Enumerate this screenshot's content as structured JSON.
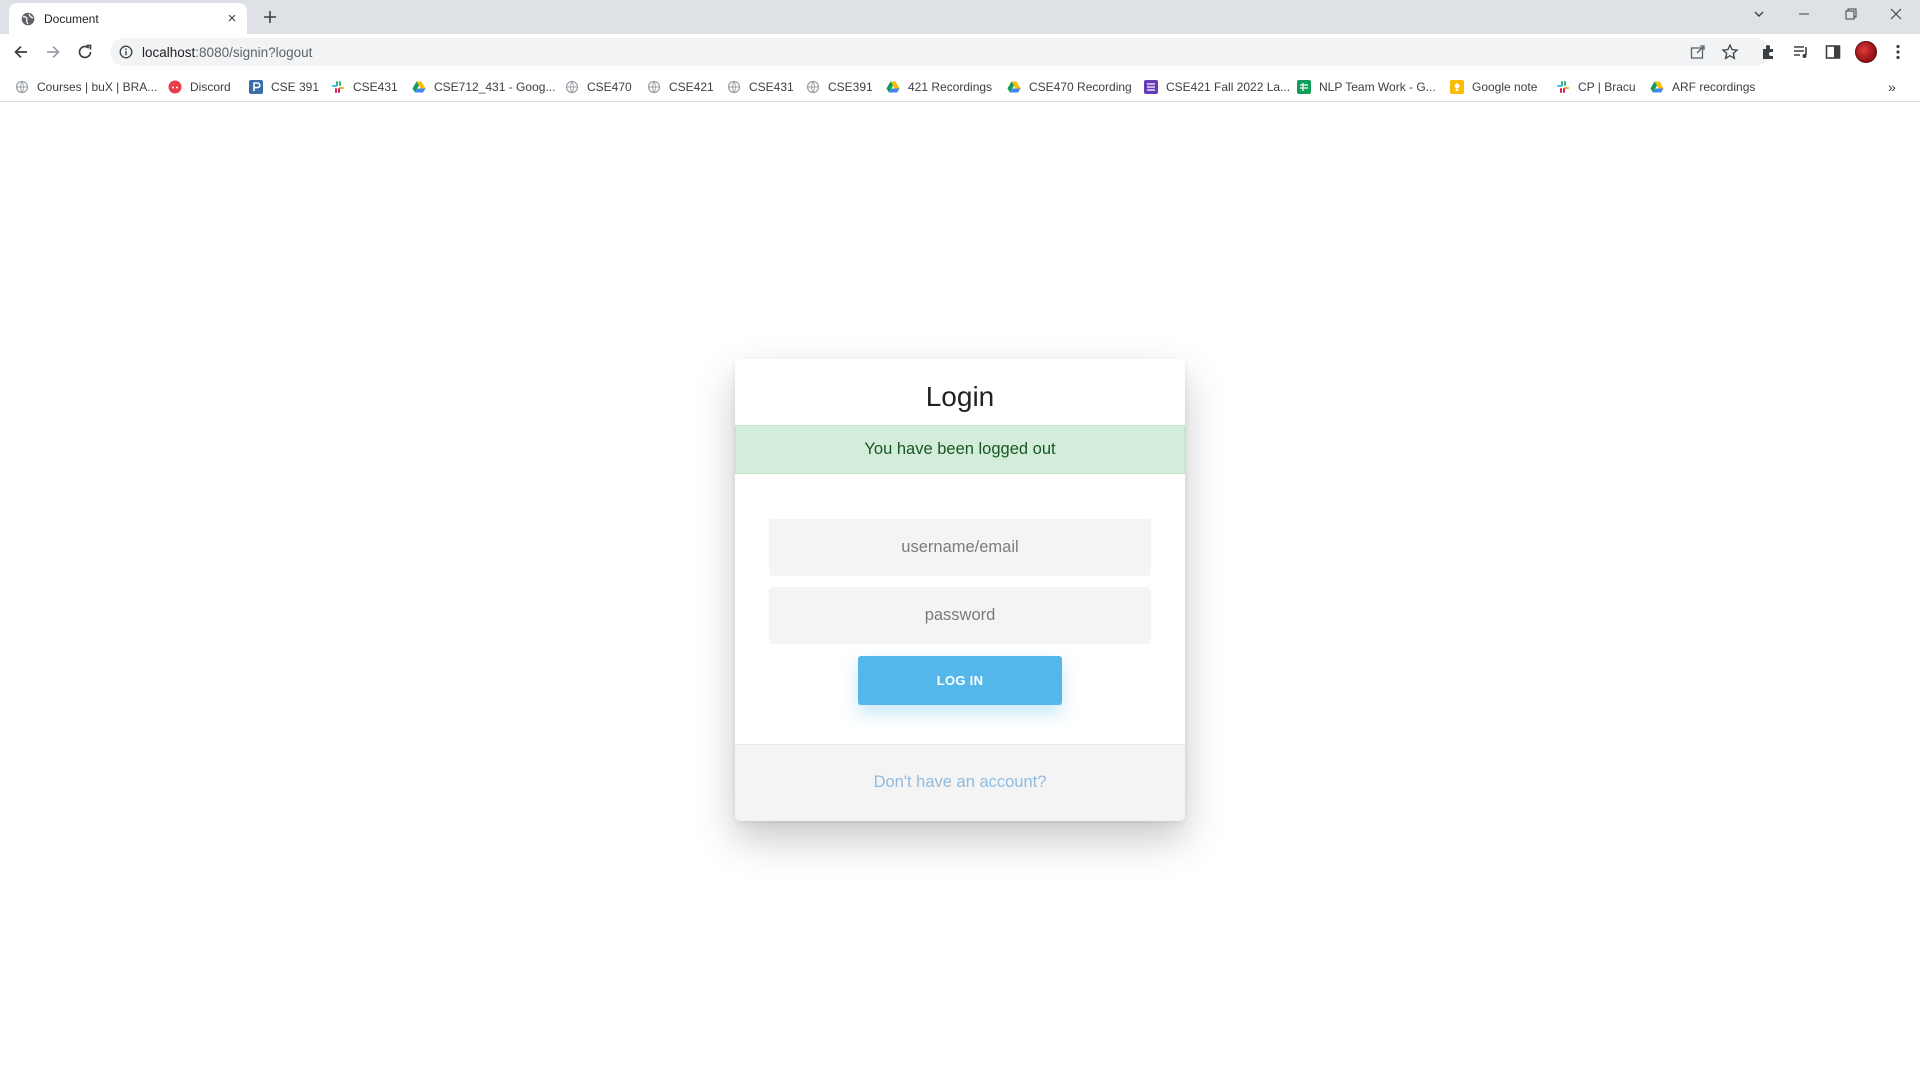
{
  "browser": {
    "tab_title": "Document",
    "tab_close": "×",
    "url_host": "localhost",
    "url_path": ":8080/signin?logout",
    "bookmarks": [
      {
        "label": "Courses | buX | BRA...",
        "icon": "globe-icon"
      },
      {
        "label": "Discord",
        "icon": "discord-icon"
      },
      {
        "label": "CSE 391",
        "icon": "p-icon"
      },
      {
        "label": "CSE431",
        "icon": "slack-icon"
      },
      {
        "label": "CSE712_431 - Goog...",
        "icon": "drive-icon"
      },
      {
        "label": "CSE470",
        "icon": "globe-icon"
      },
      {
        "label": "CSE421",
        "icon": "globe-icon"
      },
      {
        "label": "CSE431",
        "icon": "globe-icon"
      },
      {
        "label": "CSE391",
        "icon": "globe-icon"
      },
      {
        "label": "421 Recordings",
        "icon": "drive-icon"
      },
      {
        "label": "CSE470 Recording",
        "icon": "drive-icon"
      },
      {
        "label": "CSE421 Fall 2022 La...",
        "icon": "forms-icon"
      },
      {
        "label": "NLP Team Work - G...",
        "icon": "sheets-icon"
      },
      {
        "label": "Google note",
        "icon": "keep-icon"
      },
      {
        "label": "CP | Bracu",
        "icon": "slack-icon"
      },
      {
        "label": "ARF recordings",
        "icon": "drive-icon"
      }
    ],
    "more_bookmarks": "»"
  },
  "login": {
    "title": "Login",
    "alert": "You have been logged out",
    "username_placeholder": "username/email",
    "password_placeholder": "password",
    "button_label": "LOG IN",
    "signup_link": "Don't have an account?"
  }
}
